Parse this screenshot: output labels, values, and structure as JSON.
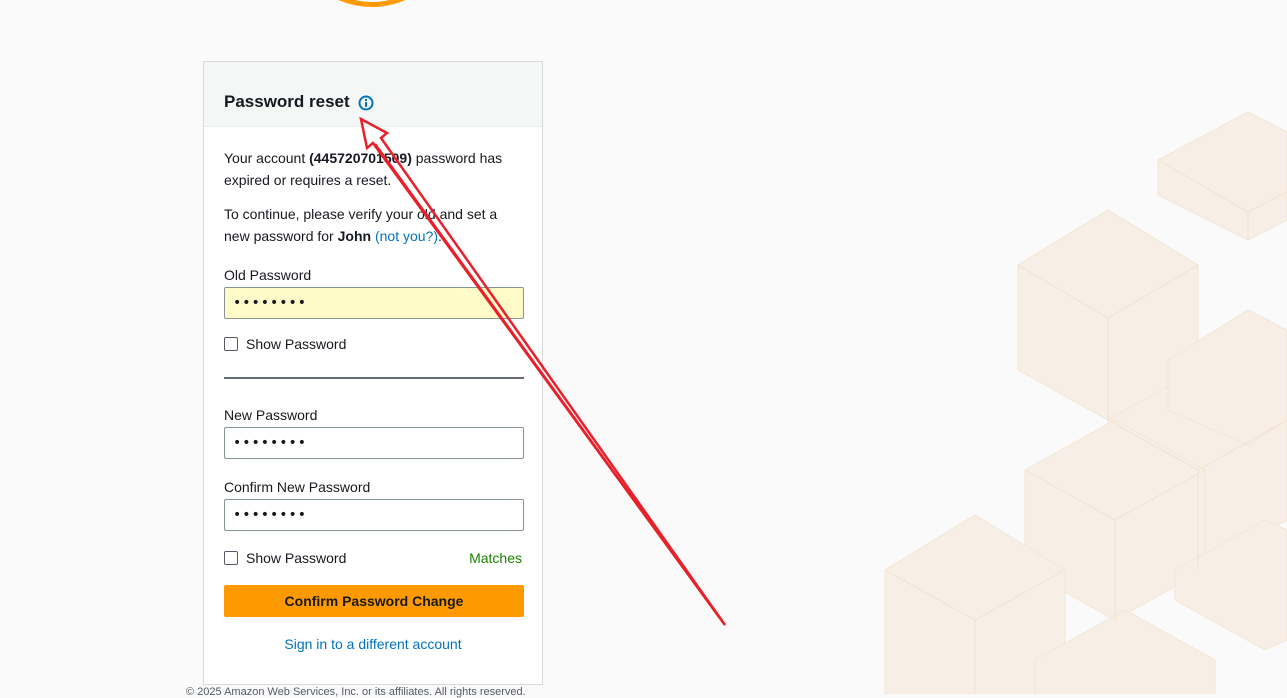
{
  "card": {
    "title": "Password reset",
    "intro_prefix": "Your account ",
    "account_id": "(445720701509)",
    "intro_suffix": " password has expired or requires a reset.",
    "continue_text": "To continue, please verify your old and set a new password for ",
    "user_name": "John",
    "not_you_link": "(not you?)",
    "not_you_suffix": "."
  },
  "form": {
    "old_password_label": "Old Password",
    "old_password_value": "••••••••",
    "show_password_label_1": "Show Password",
    "new_password_label": "New Password",
    "new_password_value": "••••••••",
    "confirm_password_label": "Confirm New Password",
    "confirm_password_value": "••••••••",
    "show_password_label_2": "Show Password",
    "match_status": "Matches",
    "submit_label": "Confirm Password Change",
    "alt_signin_link": "Sign in to a different account"
  },
  "footer": {
    "copyright": "© 2025 Amazon Web Services, Inc. or its affiliates. All rights reserved."
  },
  "colors": {
    "accent": "#ff9900",
    "link": "#0073bb",
    "success": "#1d8102",
    "autofill": "#fefbc8",
    "annotation": "#e8202a"
  },
  "icons": {
    "info": "info-icon",
    "logo": "aws-smile-logo"
  }
}
